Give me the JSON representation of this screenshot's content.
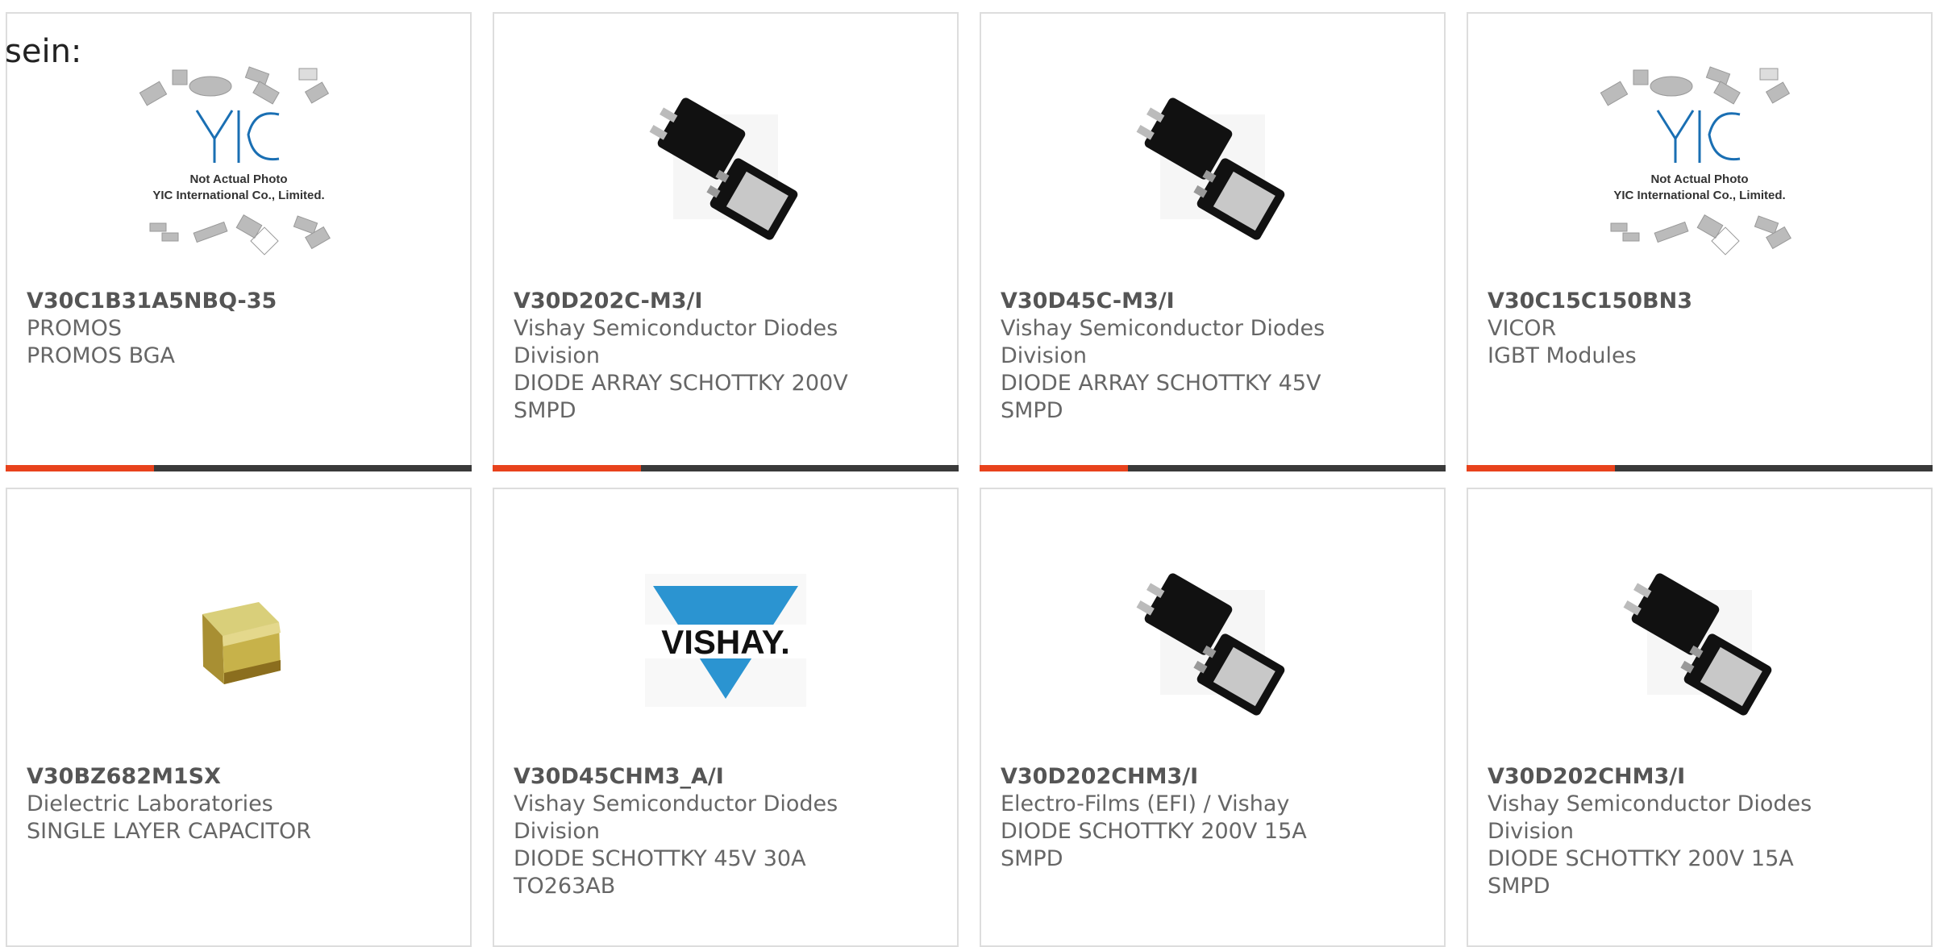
{
  "prefix_text": "sein:",
  "colors": {
    "accent": "#e8421c",
    "bar": "#3a3a3a",
    "border": "#dddddd"
  },
  "cards": [
    {
      "image": "yic-placeholder-image",
      "img_caption1": "Not Actual Photo",
      "img_caption2": "YIC International Co., Limited.",
      "img_logo": "YIC",
      "part": "V30C1B31A5NBQ-35",
      "lines": [
        "PROMOS",
        "PROMOS BGA"
      ]
    },
    {
      "image": "smpd-diode-image",
      "part": "V30D202C-M3/I",
      "lines": [
        "Vishay Semiconductor Diodes",
        "Division",
        "DIODE ARRAY SCHOTTKY 200V",
        "SMPD"
      ]
    },
    {
      "image": "smpd-diode-image",
      "part": "V30D45C-M3/I",
      "lines": [
        "Vishay Semiconductor Diodes",
        "Division",
        "DIODE ARRAY SCHOTTKY 45V",
        "SMPD"
      ]
    },
    {
      "image": "yic-placeholder-image",
      "img_caption1": "Not Actual Photo",
      "img_caption2": "YIC International Co., Limited.",
      "img_logo": "YIC",
      "part": "V30C15C150BN3",
      "lines": [
        "VICOR",
        "IGBT Modules"
      ]
    },
    {
      "image": "capacitor-image",
      "part": "V30BZ682M1SX",
      "lines": [
        "Dielectric Laboratories",
        "SINGLE LAYER CAPACITOR"
      ]
    },
    {
      "image": "vishay-logo-image",
      "img_logo": "VISHAY.",
      "part": "V30D45CHM3_A/I",
      "lines": [
        "Vishay Semiconductor Diodes",
        "Division",
        "DIODE SCHOTTKY 45V 30A",
        "TO263AB"
      ]
    },
    {
      "image": "smpd-diode-image",
      "part": "V30D202CHM3/I",
      "lines": [
        "Electro-Films (EFI) / Vishay",
        "DIODE SCHOTTKY 200V 15A",
        "SMPD"
      ]
    },
    {
      "image": "smpd-diode-image",
      "part": "V30D202CHM3/I",
      "lines": [
        "Vishay Semiconductor Diodes",
        "Division",
        "DIODE SCHOTTKY 200V 15A",
        "SMPD"
      ]
    }
  ]
}
